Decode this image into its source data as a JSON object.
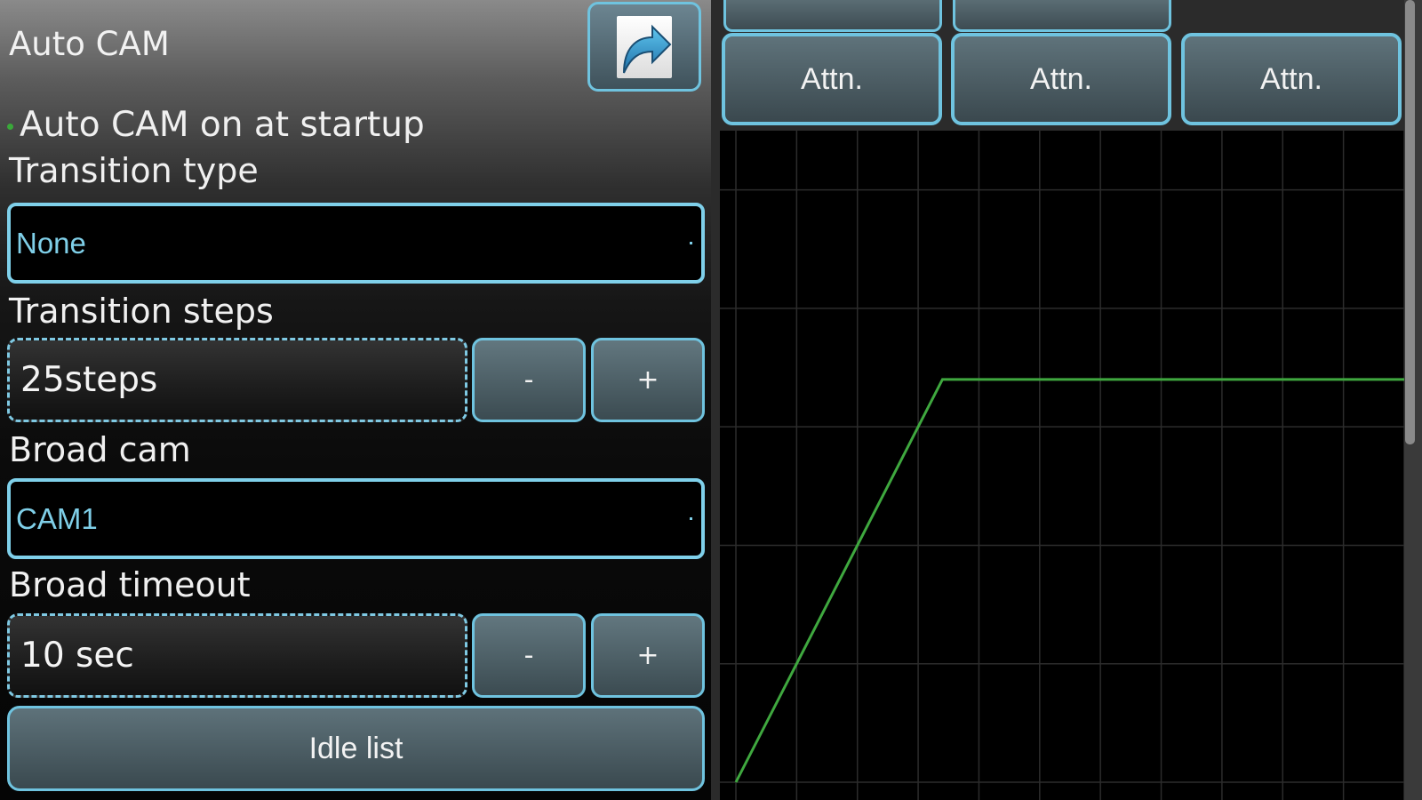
{
  "header": {
    "title": "Auto CAM",
    "share_icon": "share-arrow-icon"
  },
  "settings": {
    "startup_label": "Auto CAM on at startup",
    "transition_type": {
      "label": "Transition type",
      "value": "None"
    },
    "transition_steps": {
      "label": "Transition steps",
      "value": "25steps",
      "minus_label": "-",
      "plus_label": "+"
    },
    "broad_cam": {
      "label": "Broad cam",
      "value": "CAM1"
    },
    "broad_timeout": {
      "label": "Broad timeout",
      "value": "10 sec",
      "minus_label": "-",
      "plus_label": "+"
    },
    "idle_list_label": "Idle list"
  },
  "attn_buttons": [
    {
      "label": "Attn."
    },
    {
      "label": "Attn."
    },
    {
      "label": "Attn."
    }
  ],
  "colors": {
    "accent": "#6fc3df",
    "curve": "#3fa83f",
    "grid": "#2c2c2c"
  },
  "chart_data": {
    "type": "line",
    "series": [
      {
        "x": [
          0,
          3.4,
          11
        ],
        "y": [
          0,
          3.4,
          3.4
        ]
      }
    ],
    "xlim": [
      0,
      11
    ],
    "ylim": [
      0,
      5.5
    ],
    "grid": true
  }
}
